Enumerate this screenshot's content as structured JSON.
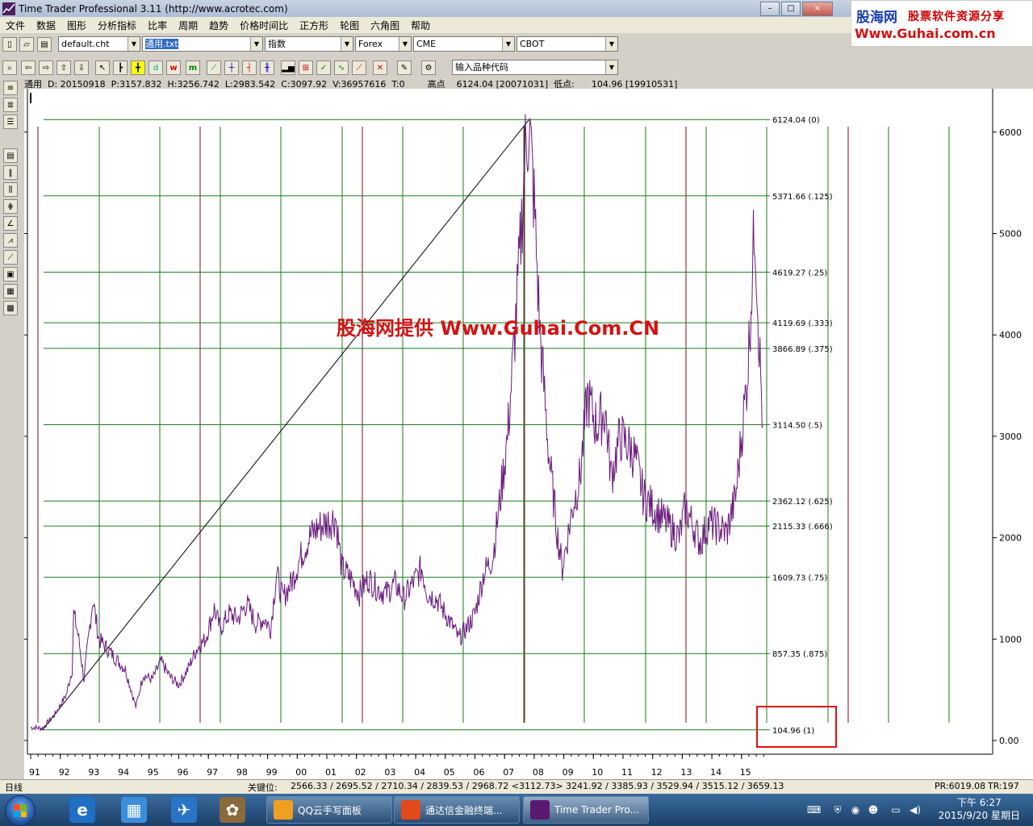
{
  "window": {
    "title": "Time Trader Professional 3.11 (http://www.acrotec.com)"
  },
  "banner": {
    "line1a": "股海网",
    "line1b": "股票软件资源分享",
    "line2": "Www.Guhai.com.cn"
  },
  "menu": [
    "文件",
    "数据",
    "图形",
    "分析指标",
    "比率",
    "周期",
    "趋势",
    "价格时间比",
    "正方形",
    "轮图",
    "六角图",
    "帮助"
  ],
  "toolbar1": {
    "combos": [
      {
        "value": "default.cht"
      },
      {
        "value": "通用.txt"
      },
      {
        "value": "指数"
      },
      {
        "value": "Forex"
      },
      {
        "value": "CME"
      },
      {
        "value": "CBOT"
      }
    ]
  },
  "toolbar2": {
    "buttons": [
      "d",
      "w",
      "m"
    ],
    "symbol_input": "输入品种代码"
  },
  "infobar": "通用  D: 20150918  P:3157.832  H:3256.742  L:2983.542  C:3097.92  V:36957616  T:0        高点    6124.04 [20071031]  低点:      104.96 [19910531]",
  "chart_data": {
    "type": "line",
    "title": "",
    "xlabel": "",
    "ylabel": "",
    "x_ticks": [
      "91",
      "92",
      "93",
      "94",
      "95",
      "96",
      "97",
      "98",
      "99",
      "00",
      "01",
      "02",
      "03",
      "04",
      "05",
      "06",
      "07",
      "08",
      "09",
      "10",
      "11",
      "12",
      "13",
      "14",
      "15"
    ],
    "y_ticks": [
      "0.00",
      "1000",
      "2000",
      "3000",
      "4000",
      "5000",
      "6000"
    ],
    "ylim": [
      0,
      6124.04
    ],
    "grid": false,
    "fib_levels": [
      {
        "price": "6124.04",
        "ratio": "(0)",
        "value": 6124.04
      },
      {
        "price": "5371.66",
        "ratio": "(.125)",
        "value": 5371.66
      },
      {
        "price": "4619.27",
        "ratio": "(.25)",
        "value": 4619.27
      },
      {
        "price": "4119.69",
        "ratio": "(.333)",
        "value": 4119.69
      },
      {
        "price": "3866.89",
        "ratio": "(.375)",
        "value": 3866.89
      },
      {
        "price": "3114.50",
        "ratio": "(.5)",
        "value": 3114.5
      },
      {
        "price": "2362.12",
        "ratio": "(.625)",
        "value": 2362.12
      },
      {
        "price": "2115.33",
        "ratio": "(.666)",
        "value": 2115.33
      },
      {
        "price": "1609.73",
        "ratio": "(.75)",
        "value": 1609.73
      },
      {
        "price": "857.35",
        "ratio": "(.875)",
        "value": 857.35
      },
      {
        "price": "104.96",
        "ratio": "(1)",
        "value": 104.96
      }
    ],
    "series": [
      {
        "x": [
          1991.0,
          1991.4,
          1991.8,
          1992.2,
          1992.4,
          1992.45,
          1992.6,
          1992.8,
          1993.1,
          1993.3,
          1993.6,
          1993.9,
          1994.2,
          1994.55,
          1994.8,
          1995.1,
          1995.4,
          1995.7,
          1996.0,
          1996.3,
          1996.6,
          1996.9,
          1997.2,
          1997.4,
          1997.7,
          1998.0,
          1998.3,
          1998.6,
          1998.9,
          1999.1,
          1999.3,
          1999.5,
          1999.8,
          2000.1,
          2000.4,
          2000.7,
          2001.0,
          2001.3,
          2001.5,
          2001.8,
          2002.1,
          2002.4,
          2002.7,
          2003.0,
          2003.3,
          2003.6,
          2003.9,
          2004.2,
          2004.4,
          2004.7,
          2005.0,
          2005.3,
          2005.45,
          2005.7,
          2006.0,
          2006.3,
          2006.6,
          2006.9,
          2007.1,
          2007.3,
          2007.5,
          2007.7,
          2007.83,
          2008.0,
          2008.2,
          2008.5,
          2008.8,
          2008.95,
          2009.3,
          2009.55,
          2009.8,
          2010.1,
          2010.4,
          2010.6,
          2010.9,
          2011.2,
          2011.4,
          2011.7,
          2012.0,
          2012.3,
          2012.6,
          2012.9,
          2013.1,
          2013.4,
          2013.6,
          2013.9,
          2014.2,
          2014.5,
          2014.8,
          2015.0,
          2015.2,
          2015.35,
          2015.45,
          2015.6,
          2015.72
        ],
        "values": [
          130,
          120,
          250,
          450,
          700,
          1250,
          1050,
          600,
          1400,
          1000,
          900,
          800,
          700,
          330,
          650,
          600,
          780,
          630,
          550,
          700,
          900,
          1000,
          1300,
          1100,
          1250,
          1200,
          1350,
          1150,
          1200,
          1100,
          1650,
          1400,
          1550,
          1800,
          2000,
          2100,
          2150,
          2200,
          1700,
          1600,
          1450,
          1600,
          1500,
          1450,
          1550,
          1400,
          1550,
          1700,
          1450,
          1400,
          1250,
          1100,
          1000,
          1100,
          1250,
          1650,
          1800,
          2500,
          3000,
          3800,
          4700,
          5800,
          6100,
          5300,
          4000,
          2800,
          2000,
          1700,
          2300,
          2600,
          3400,
          3100,
          3250,
          2600,
          3000,
          2900,
          2800,
          2400,
          2300,
          2200,
          2100,
          2000,
          2300,
          2100,
          1950,
          2150,
          2100,
          2050,
          2400,
          3000,
          3600,
          4500,
          5150,
          3900,
          3100
        ]
      }
    ]
  },
  "status": {
    "left": "日线",
    "key_label": "关键位:",
    "key_values": "2566.33 / 2695.52 / 2710.34 / 2839.53 / 2968.72 <3112.73> 3241.92 / 3385.93 / 3529.94 / 3515.12 / 3659.13",
    "pr": "PR:6019.08",
    "tr": "TR:197"
  },
  "watermark": "股海网提供 Www.Guhai.Com.CN",
  "taskbar": {
    "tasks": [
      {
        "label": "QQ云手写面板",
        "color": "#f0a020"
      },
      {
        "label": "通达信金融终端...",
        "color": "#e24a1c"
      },
      {
        "label": "Time Trader Pro...",
        "color": "#5a1a70"
      }
    ],
    "clock_time": "下午 6:27",
    "clock_date": "2015/9/20 星期日"
  },
  "colors": {
    "price": "#6a1b7d",
    "fib": "#1e7a1e",
    "cycle_red": "#7a1020",
    "highlight": "#e01010"
  }
}
